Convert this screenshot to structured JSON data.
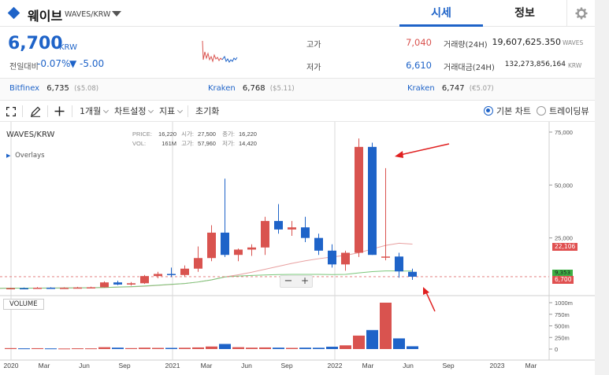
{
  "header": {
    "coin_name": "웨이브",
    "pair": "WAVES/KRW",
    "tabs": [
      {
        "label": "시세",
        "active": true
      },
      {
        "label": "정보",
        "active": false
      }
    ]
  },
  "quote": {
    "price": "6,700",
    "currency": "KRW",
    "change_label": "전일대비",
    "change_pct": "-0.07%",
    "change_abs": "▼ -5.00",
    "high_label": "고가",
    "high_value": "7,040",
    "low_label": "저가",
    "low_value": "6,610",
    "volume_label": "거래량(24H)",
    "volume_value": "19,607,625.350",
    "volume_unit": "WAVES",
    "amount_label": "거래대금(24H)",
    "amount_value": "132,273,856,164",
    "amount_unit": "KRW"
  },
  "exchanges": [
    {
      "name": "Bitfinex",
      "price": "6,735",
      "sub": "($5.08)"
    },
    {
      "name": "Kraken",
      "price": "6,768",
      "sub": "($5.11)"
    },
    {
      "name": "Kraken",
      "price": "6,747",
      "sub": "(€5.07)"
    }
  ],
  "toolbar": {
    "period": "1개월",
    "chart_settings": "차트설정",
    "indicators": "지표",
    "reset": "초기화",
    "view_basic": "기본 차트",
    "view_tv": "트레이딩뷰"
  },
  "chart": {
    "symbol": "WAVES/KRW",
    "overlays": "Overlays",
    "volume_label": "VOLUME",
    "info": {
      "price_label": "PRICE:",
      "price": "16,220",
      "vol_label": "VOL:",
      "vol": "161M",
      "open_label": "시가:",
      "open": "27,500",
      "high_label": "고가:",
      "high": "57,960",
      "close_label": "종가:",
      "close": "16,220",
      "low_label": "저가:",
      "low": "14,420"
    },
    "badges": {
      "ma_long": "22,106",
      "ma_short": "9,353",
      "last": "6,700"
    },
    "colors": {
      "up": "#d9534f",
      "down": "#1e63c8",
      "ma_long": "#e8a0a0",
      "ma_short": "#7ac77a",
      "badge_red": "#e05050",
      "badge_green": "#3cb043",
      "arrow": "#e02020"
    }
  },
  "chart_data": {
    "type": "candlestick",
    "price_axis": {
      "ticks": [
        "75,000",
        "50,000",
        "25,000"
      ],
      "values": [
        75000,
        50000,
        25000
      ],
      "range": [
        0,
        80000
      ]
    },
    "volume_axis": {
      "ticks": [
        "1000m",
        "750m",
        "500m",
        "250m",
        "0"
      ],
      "values": [
        1000,
        750,
        500,
        250,
        0
      ],
      "range": [
        0,
        1100
      ]
    },
    "x_ticks": [
      "2020",
      "Mar",
      "Jun",
      "Sep",
      "2021",
      "Mar",
      "Jun",
      "Sep",
      "2022",
      "Mar",
      "Jun",
      "Sep",
      "2023",
      "Mar"
    ],
    "candles": [
      {
        "o": 1200,
        "h": 1500,
        "l": 1000,
        "c": 1300,
        "v": 20
      },
      {
        "o": 1300,
        "h": 1600,
        "l": 1100,
        "c": 1250,
        "v": 15
      },
      {
        "o": 1250,
        "h": 1800,
        "l": 1100,
        "c": 1500,
        "v": 18
      },
      {
        "o": 1500,
        "h": 1700,
        "l": 1200,
        "c": 1350,
        "v": 14
      },
      {
        "o": 1350,
        "h": 1700,
        "l": 1200,
        "c": 1450,
        "v": 12
      },
      {
        "o": 1450,
        "h": 1900,
        "l": 1300,
        "c": 1600,
        "v": 16
      },
      {
        "o": 1600,
        "h": 2000,
        "l": 1400,
        "c": 1700,
        "v": 15
      },
      {
        "o": 1700,
        "h": 4500,
        "l": 1600,
        "c": 4000,
        "v": 40
      },
      {
        "o": 4000,
        "h": 4800,
        "l": 2700,
        "c": 3000,
        "v": 30
      },
      {
        "o": 3000,
        "h": 4200,
        "l": 2500,
        "c": 3600,
        "v": 20
      },
      {
        "o": 3600,
        "h": 7500,
        "l": 3300,
        "c": 7000,
        "v": 30
      },
      {
        "o": 7000,
        "h": 9000,
        "l": 6000,
        "c": 8000,
        "v": 25
      },
      {
        "o": 8000,
        "h": 11000,
        "l": 6500,
        "c": 7500,
        "v": 25
      },
      {
        "o": 7500,
        "h": 12000,
        "l": 6500,
        "c": 10500,
        "v": 28
      },
      {
        "o": 10500,
        "h": 21000,
        "l": 9000,
        "c": 15500,
        "v": 35
      },
      {
        "o": 15500,
        "h": 31000,
        "l": 14000,
        "c": 27500,
        "v": 55
      },
      {
        "o": 27500,
        "h": 53000,
        "l": 16000,
        "c": 17000,
        "v": 110
      },
      {
        "o": 17000,
        "h": 20000,
        "l": 14000,
        "c": 19500,
        "v": 40
      },
      {
        "o": 19500,
        "h": 22000,
        "l": 16500,
        "c": 20500,
        "v": 30
      },
      {
        "o": 20500,
        "h": 35000,
        "l": 17000,
        "c": 33000,
        "v": 35
      },
      {
        "o": 33000,
        "h": 41000,
        "l": 27000,
        "c": 29000,
        "v": 30
      },
      {
        "o": 29000,
        "h": 33000,
        "l": 26000,
        "c": 30000,
        "v": 25
      },
      {
        "o": 30000,
        "h": 35000,
        "l": 23000,
        "c": 25000,
        "v": 30
      },
      {
        "o": 25000,
        "h": 27000,
        "l": 17000,
        "c": 19000,
        "v": 28
      },
      {
        "o": 19000,
        "h": 22000,
        "l": 11000,
        "c": 12500,
        "v": 50
      },
      {
        "o": 12500,
        "h": 19000,
        "l": 9500,
        "c": 18000,
        "v": 80
      },
      {
        "o": 18000,
        "h": 72000,
        "l": 16000,
        "c": 68000,
        "v": 290
      },
      {
        "o": 68000,
        "h": 70000,
        "l": 17000,
        "c": 17000,
        "v": 410
      },
      {
        "o": 16220,
        "h": 57960,
        "l": 14420,
        "c": 16220,
        "v": 1000
      },
      {
        "o": 16220,
        "h": 18000,
        "l": 6200,
        "c": 9200,
        "v": 230
      },
      {
        "o": 9000,
        "h": 10500,
        "l": 5200,
        "c": 6700,
        "v": 60
      }
    ],
    "ma_long": [
      1300,
      1300,
      1320,
      1350,
      1380,
      1400,
      1450,
      1600,
      1750,
      1900,
      2200,
      2600,
      3000,
      3500,
      4200,
      5200,
      6600,
      7600,
      8800,
      10200,
      11600,
      13000,
      14200,
      15200,
      16000,
      16800,
      18000,
      19800,
      21500,
      22500,
      22106
    ],
    "ma_short": [
      1300,
      1300,
      1320,
      1350,
      1380,
      1420,
      1480,
      1600,
      1800,
      2000,
      2300,
      2700,
      3100,
      3500,
      4200,
      5200,
      6600,
      7000,
      7300,
      7500,
      7700,
      7800,
      7800,
      7800,
      7700,
      7800,
      8500,
      9100,
      9400,
      9400,
      9353
    ]
  }
}
